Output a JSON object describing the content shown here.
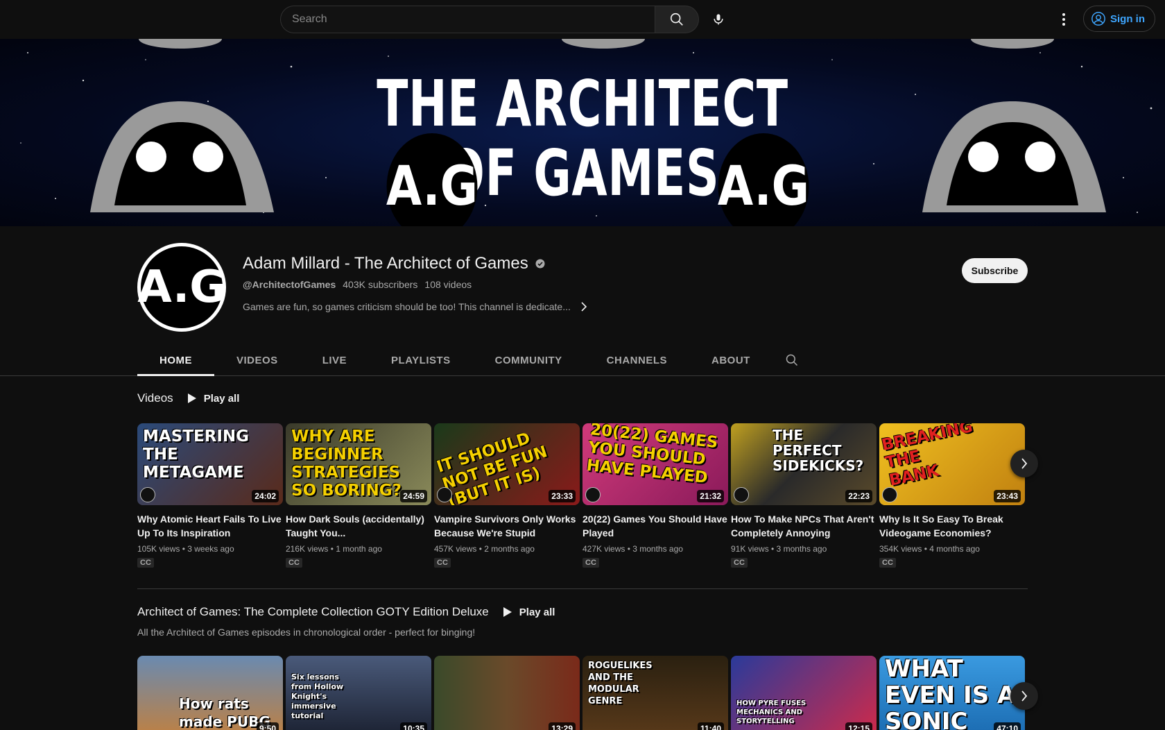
{
  "search": {
    "placeholder": "Search"
  },
  "header": {
    "signin_label": "Sign in"
  },
  "banner": {
    "line1": "THE ARCHITECT",
    "line2": "OF GAMES",
    "badge": "A.G"
  },
  "channel": {
    "avatar_text": "A.G",
    "name": "Adam Millard - The Architect of Games",
    "handle": "@ArchitectofGames",
    "subscribers": "403K subscribers",
    "videos": "108 videos",
    "description": "Games are fun, so games criticism should be too! This channel is dedicate...",
    "subscribe_label": "Subscribe"
  },
  "tabs": [
    "HOME",
    "VIDEOS",
    "LIVE",
    "PLAYLISTS",
    "COMMUNITY",
    "CHANNELS",
    "ABOUT"
  ],
  "shelf1": {
    "title": "Videos",
    "play_all": "Play all",
    "videos": [
      {
        "thumb_text": "Mastering the Metagame",
        "duration": "24:02",
        "title": "Why Atomic Heart Fails To Live Up To Its Inspiration",
        "meta": "105K views • 3 weeks ago",
        "badge": "CC",
        "bg": "#2a4a7a"
      },
      {
        "thumb_text": "Why are beginner strategies so boring?",
        "duration": "24:59",
        "title": "How Dark Souls (accidentally) Taught You...",
        "meta": "216K views • 1 month ago",
        "badge": "CC",
        "bg": "#5a5a3a"
      },
      {
        "thumb_text": "It should not be fun (but it is)",
        "duration": "23:33",
        "title": "Vampire Survivors Only Works Because We're Stupid",
        "meta": "457K views • 2 months ago",
        "badge": "CC",
        "bg": "#7a1a1a"
      },
      {
        "thumb_text": "20(22) Games you should have played",
        "duration": "21:32",
        "title": "20(22) Games You Should Have Played",
        "meta": "427K views • 3 months ago",
        "badge": "CC",
        "bg": "#c02a6a"
      },
      {
        "thumb_text": "The perfect sidekicks?",
        "duration": "22:23",
        "title": "How To Make NPCs That Aren't Completely Annoying",
        "meta": "91K views • 3 months ago",
        "badge": "CC",
        "bg": "#3a3a2a"
      },
      {
        "thumb_text": "Breaking the bank",
        "duration": "23:43",
        "title": "Why Is It So Easy To Break Videogame Economies?",
        "meta": "354K views • 4 months ago",
        "badge": "CC",
        "bg": "#d4a010"
      }
    ]
  },
  "shelf2": {
    "title": "Architect of Games: The Complete Collection GOTY Edition Deluxe",
    "play_all": "Play all",
    "subtitle": "All the Architect of Games episodes in chronological order - perfect for binging!",
    "videos": [
      {
        "thumb_text": "How rats made PUBG memor...",
        "duration": "9:50",
        "bg": "#8a6a3a"
      },
      {
        "thumb_text": "Six lessons from Hollow Knight's immersive tutorial",
        "duration": "10:35",
        "bg": "#2a3550"
      },
      {
        "thumb_text": "",
        "duration": "13:29",
        "bg": "#3a2a1a"
      },
      {
        "thumb_text": "Roguelikes and the modular genre",
        "duration": "11:40",
        "bg": "#2a2010"
      },
      {
        "thumb_text": "How Pyre fuses mechanics and storytelling",
        "duration": "12:15",
        "bg": "#1a2a6a"
      },
      {
        "thumb_text": "What even is a Sonic anyway?",
        "duration": "47:10",
        "bg": "#2a8ad4"
      }
    ]
  }
}
